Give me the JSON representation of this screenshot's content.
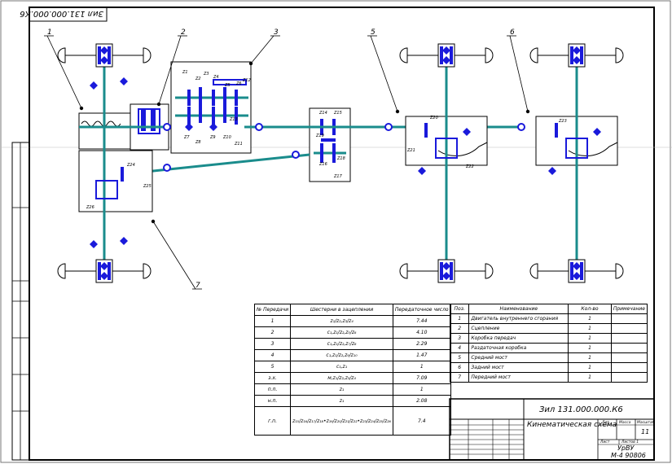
{
  "stamp_top": "Зил 131.000.000.К6",
  "callouts": [
    "1",
    "2",
    "3",
    "5",
    "6",
    "7"
  ],
  "gear_labels": {
    "gearbox": [
      "Z1",
      "Z2",
      "Z3",
      "Z4",
      "Z5",
      "Z6",
      "Z7",
      "Z8",
      "Z9",
      "Z10",
      "Z11",
      "Z12",
      "Z13",
      "M1"
    ],
    "transfer": [
      "Z14",
      "Z15",
      "Z16",
      "Z17",
      "Z18",
      "Z19"
    ],
    "rear_axles": [
      "Z20",
      "Z21",
      "Z22",
      "Z23"
    ],
    "front_axle": [
      "Z24",
      "Z25",
      "Z26"
    ]
  },
  "gear_table": {
    "headers": [
      "№ Передачи",
      "Шестерни в зацеплении",
      "Передаточное число"
    ],
    "rows": [
      [
        "1",
        "z₁/z₂,z₃/z₄",
        "7.44"
      ],
      [
        "2",
        "c₁,z₁/z₂,z₅/z₆",
        "4.10"
      ],
      [
        "3",
        "c₁,z₁/z₂,z₇/z₈",
        "2.29"
      ],
      [
        "4",
        "c₁,z₁/z₂,z₉/z₁₀",
        "1.47"
      ],
      [
        "5",
        "c₁,z₁",
        "1"
      ],
      [
        "з.х.",
        "м,z₁/z₂,z₃/z₄",
        "7.09"
      ],
      [
        "п.п.",
        "z₁",
        "1"
      ],
      [
        "н.п.",
        "z₁",
        "2.08"
      ],
      [
        "г.п.",
        "z₁₅/z₁₆/z₁₇/z₁₈•z₁₉/z₂₀/z₂₁/z₂₂•z₂₃/z₂₄/z₂₅/z₂₆",
        "7.4"
      ]
    ]
  },
  "parts_table": {
    "headers": [
      "Поз.",
      "Наименование",
      "Кол-во",
      "Примечание"
    ],
    "rows": [
      [
        "1",
        "Двигатель внутреннего сгорания",
        "1",
        ""
      ],
      [
        "2",
        "Сцепление",
        "1",
        ""
      ],
      [
        "3",
        "Коробка передач",
        "1",
        ""
      ],
      [
        "4",
        "Раздаточная коробка",
        "1",
        ""
      ],
      [
        "5",
        "Средний мост",
        "1",
        ""
      ],
      [
        "6",
        "Задний мост",
        "1",
        ""
      ],
      [
        "7",
        "Передний мост",
        "1",
        ""
      ]
    ]
  },
  "title_block": {
    "doc_number": "Зил 131.000.000.К6",
    "title": "Кинематическая схема",
    "sheet": "11",
    "org_line1": "УрВУ",
    "org_line2": "М-4 90806",
    "col_lit": "Лит.",
    "col_mass": "Масса",
    "col_scale": "Масштаб",
    "col_sheet": "Лист",
    "col_sheets": "Листов 1"
  },
  "colors": {
    "shaft": "#1a8c8c",
    "gear": "#1a1adb",
    "line": "#000000"
  }
}
